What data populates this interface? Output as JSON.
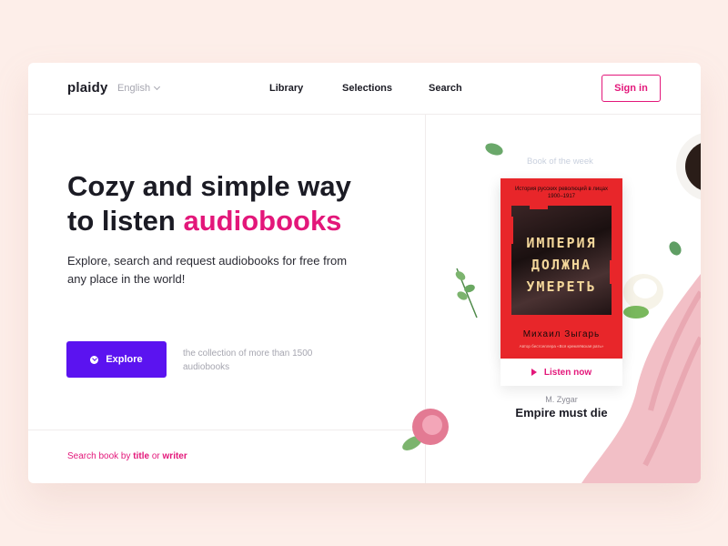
{
  "header": {
    "logo": "plaidy",
    "language": "English",
    "nav": [
      "Library",
      "Selections",
      "Search"
    ],
    "signin_label": "Sign in"
  },
  "hero": {
    "headline_line1": "Cozy and simple way",
    "headline_line2_prefix": "to listen",
    "headline_accent": "audiobooks",
    "subtitle": "Explore, search and request audiobooks for free from any place in the world!",
    "explore_label": "Explore",
    "collection_text": "the collection of more than 1500 audiobooks"
  },
  "search_hint": {
    "prefix": "Search book by",
    "option1": "title",
    "joiner": "or",
    "option2": "writer"
  },
  "book_of_week": {
    "section_label": "Book of the week",
    "cover_top": "История русских революций в лицах 1900–1917",
    "cover_line1": "ИМПЕРИЯ",
    "cover_line2": "ДОЛЖНА",
    "cover_line3": "УМЕРЕТЬ",
    "cover_author": "Михаил Зыгарь",
    "cover_footer": "Автор бестселлера «Вся кремлёвская рать»",
    "listen_label": "Listen now",
    "author": "M. Zygar",
    "title": "Empire must die"
  },
  "colors": {
    "accent": "#e3177a",
    "primary_button": "#5b13f0",
    "background": "#fdeee9",
    "book_cover": "#e8262a"
  },
  "icons": [
    "chevron-down-icon",
    "chevron-circle-icon",
    "play-icon"
  ]
}
